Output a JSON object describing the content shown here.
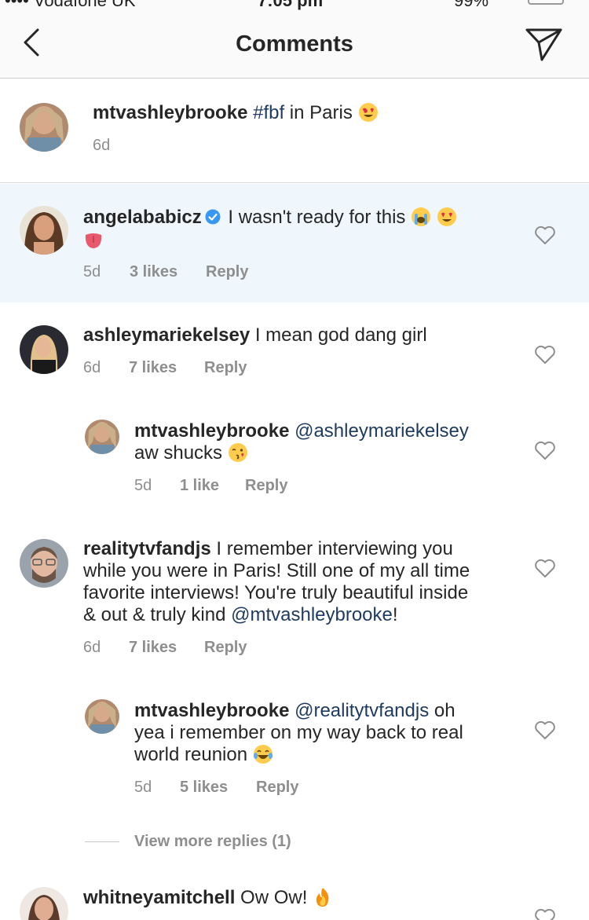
{
  "status_bar": {
    "carrier": "•••• Vodafone UK",
    "time": "7:05 pm",
    "battery": "99%"
  },
  "header": {
    "title": "Comments"
  },
  "caption": {
    "username": "mtvashleybrooke",
    "hashtag": "#fbf",
    "text": " in Paris ",
    "emoji": "heart-eyes-emoji",
    "time": "6d"
  },
  "comments": [
    {
      "username": "angelababicz",
      "verified": true,
      "text": " I wasn't ready for this ",
      "emojis": [
        "loudly-crying-emoji",
        "heart-eyes-emoji",
        "tongue-emoji"
      ],
      "time": "5d",
      "likes": "3 likes",
      "reply": "Reply"
    },
    {
      "username": "ashleymariekelsey",
      "text": " I mean god dang girl",
      "time": "6d",
      "likes": "7 likes",
      "reply": "Reply",
      "replies": [
        {
          "username": "mtvashleybrooke",
          "mention": "@ashleymariekelsey",
          "text": "aw shucks ",
          "emoji": "kissing-wink-emoji",
          "time": "5d",
          "likes": "1 like",
          "reply": "Reply"
        }
      ]
    },
    {
      "username": "realitytvfandjs",
      "text_line1": " I remember interviewing you",
      "text_line2": "while you were in Paris! Still one of my all time",
      "text_line3": "favorite interviews! You're truly beautiful inside",
      "text_line4_prefix": "& out & truly kind ",
      "mention": "@mtvashleybrooke",
      "text_line4_suffix": "!",
      "time": "6d",
      "likes": "7 likes",
      "reply": "Reply",
      "replies": [
        {
          "username": "mtvashleybrooke",
          "mention": "@realitytvfandjs",
          "text_line1": " oh",
          "text_line2": "yea i remember on my way back to real",
          "text_line3": "world reunion ",
          "emoji": "tears-of-joy-emoji",
          "time": "5d",
          "likes": "5 likes",
          "reply": "Reply"
        }
      ],
      "view_more": "View more replies (1)"
    },
    {
      "username": "whitneyamitchell",
      "text": " Ow Ow! ",
      "emoji": "fire-emoji"
    }
  ],
  "colors": {
    "text": "#262626",
    "secondary": "#8e8e8e",
    "link": "#1e3a5f",
    "highlight_bg": "#eff6fc",
    "verified_blue": "#3897f0"
  }
}
